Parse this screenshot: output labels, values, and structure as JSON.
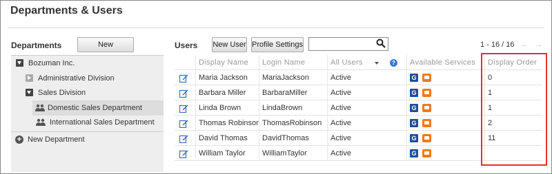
{
  "page": {
    "title": "Departments & Users"
  },
  "departments": {
    "label": "Departments",
    "new_button": "New Department",
    "tree": [
      {
        "label": "Bozuman Inc."
      },
      {
        "label": "Administrative Division"
      },
      {
        "label": "Sales Division"
      },
      {
        "label": "Domestic Sales Department"
      },
      {
        "label": "International Sales Department"
      }
    ],
    "add_label": "New Department"
  },
  "users": {
    "label": "Users",
    "new_user_button": "New User",
    "profile_settings_button": "Profile Settings",
    "search": {
      "value": "",
      "placeholder": ""
    },
    "pager": {
      "text": "1 - 16 / 16",
      "prev": "←",
      "next": "→"
    },
    "columns": {
      "display_name": "Display Name",
      "login_name": "Login Name",
      "status_filter": "All Users",
      "available_services": "Available Services",
      "display_order": "Display Order"
    },
    "rows": [
      {
        "display_name": "Maria Jackson",
        "login_name": "MariaJackson",
        "status": "Active",
        "order": "0"
      },
      {
        "display_name": "Barbara Miller",
        "login_name": "BarbaraMiller",
        "status": "Active",
        "order": "1"
      },
      {
        "display_name": "Linda Brown",
        "login_name": "LindaBrown",
        "status": "Active",
        "order": "1"
      },
      {
        "display_name": "Thomas Robinson",
        "login_name": "ThomasRobinson",
        "status": "Active",
        "order": "2"
      },
      {
        "display_name": "David Thomas",
        "login_name": "DavidThomas",
        "status": "Active",
        "order": "11"
      },
      {
        "display_name": "William Taylor",
        "login_name": "WilliamTaylor",
        "status": "Active",
        "order": ""
      }
    ],
    "service_icons": {
      "garoon": "G",
      "office_color": "#f07b1a",
      "garoon_color": "#1d4f9a"
    }
  },
  "colors": {
    "highlight": "#e03030"
  }
}
